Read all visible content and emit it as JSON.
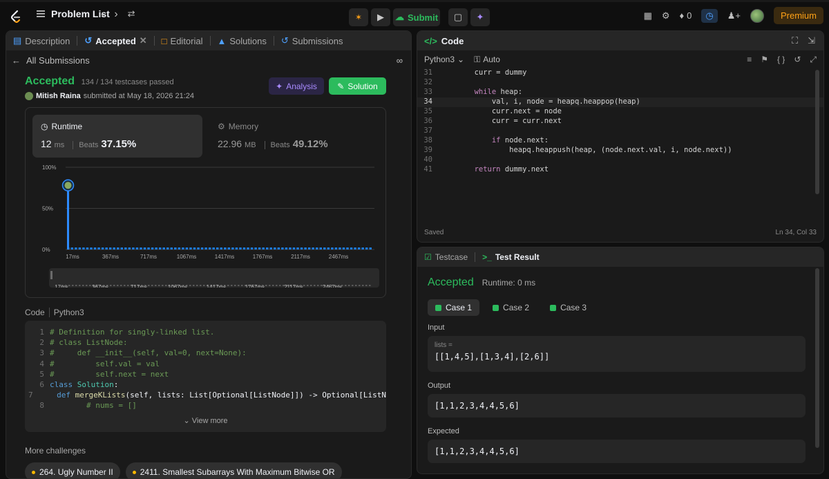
{
  "topbar": {
    "problem_list": "Problem List",
    "submit": "Submit",
    "streak": "0",
    "premium": "Premium"
  },
  "left_tabs": [
    {
      "label": "Description"
    },
    {
      "label": "Accepted"
    },
    {
      "label": "Editorial"
    },
    {
      "label": "Solutions"
    },
    {
      "label": "Submissions"
    }
  ],
  "submission": {
    "back_label": "All Submissions",
    "status": "Accepted",
    "passed": "134 / 134 testcases passed",
    "user": "Mitish Raina",
    "submitted_text": "submitted at May 18, 2026 21:24",
    "analysis_label": "Analysis",
    "solution_label": "Solution"
  },
  "runtime": {
    "label": "Runtime",
    "value": "12",
    "unit": "ms",
    "beats_label": "Beats",
    "beats": "37.15%"
  },
  "memory": {
    "label": "Memory",
    "value": "22.96",
    "unit": "MB",
    "beats_label": "Beats",
    "beats": "49.12%"
  },
  "chart_data": {
    "type": "bar",
    "y_ticks": [
      "100%",
      "50%",
      "0%"
    ],
    "x_ticks": [
      "17ms",
      "367ms",
      "717ms",
      "1067ms",
      "1417ms",
      "1767ms",
      "2117ms",
      "2467ms"
    ],
    "highlight_bar": {
      "x": "17ms",
      "value": 0.78
    },
    "ylim": [
      0,
      1
    ]
  },
  "code_section": {
    "label": "Code",
    "lang": "Python3",
    "view_more": "View more",
    "lines": [
      {
        "n": "1",
        "html": "<span class='cm'># Definition for singly-linked list.</span>"
      },
      {
        "n": "2",
        "html": "<span class='cm'># class ListNode:</span>"
      },
      {
        "n": "3",
        "html": "<span class='cm'>#     def __init__(self, val=0, next=None):</span>"
      },
      {
        "n": "4",
        "html": "<span class='cm'>#         self.val = val</span>"
      },
      {
        "n": "5",
        "html": "<span class='cm'>#         self.next = next</span>"
      },
      {
        "n": "6",
        "html": "<span class='lp1'>class</span> <span class='cl'>Solution</span>:"
      },
      {
        "n": "7",
        "html": "    <span class='lp1'>def</span> <span class='fn'>mergeKLists</span>(self, lists: List[Optional[ListNode]]) -> Optional[ListN"
      },
      {
        "n": "8",
        "html": "        <span class='cm'># nums = []</span>"
      }
    ]
  },
  "more_challenges": {
    "label": "More challenges",
    "items": [
      "264. Ugly Number II",
      "2411. Smallest Subarrays With Maximum Bitwise OR"
    ]
  },
  "editor": {
    "tab": "Code",
    "lang": "Python3",
    "mode": "Auto",
    "saved": "Saved",
    "cursor": "Ln 34, Col 33",
    "lines": [
      {
        "n": "31",
        "html": "        curr = dummy"
      },
      {
        "n": "32",
        "html": ""
      },
      {
        "n": "33",
        "html": "        <span class='kw'>while</span> heap:"
      },
      {
        "n": "34",
        "html": "            val, i, node = heapq.heappop(heap)",
        "cur": true
      },
      {
        "n": "35",
        "html": "            curr.next = node"
      },
      {
        "n": "36",
        "html": "            curr = curr.next"
      },
      {
        "n": "37",
        "html": ""
      },
      {
        "n": "38",
        "html": "            <span class='kw'>if</span> node.next:"
      },
      {
        "n": "39",
        "html": "                heapq.heappush(heap, (node.next.val, i, node.next))"
      },
      {
        "n": "40",
        "html": ""
      },
      {
        "n": "41",
        "html": "        <span class='kw'>return</span> dummy.next"
      }
    ]
  },
  "test": {
    "tab_testcase": "Testcase",
    "tab_result": "Test Result",
    "status": "Accepted",
    "runtime": "Runtime: 0 ms",
    "cases": [
      "Case 1",
      "Case 2",
      "Case 3"
    ],
    "input_label": "Input",
    "input_var": "lists =",
    "input_value": "[[1,4,5],[1,3,4],[2,6]]",
    "output_label": "Output",
    "output_value": "[1,1,2,3,4,4,5,6]",
    "expected_label": "Expected",
    "expected_value": "[1,1,2,3,4,4,5,6]"
  }
}
